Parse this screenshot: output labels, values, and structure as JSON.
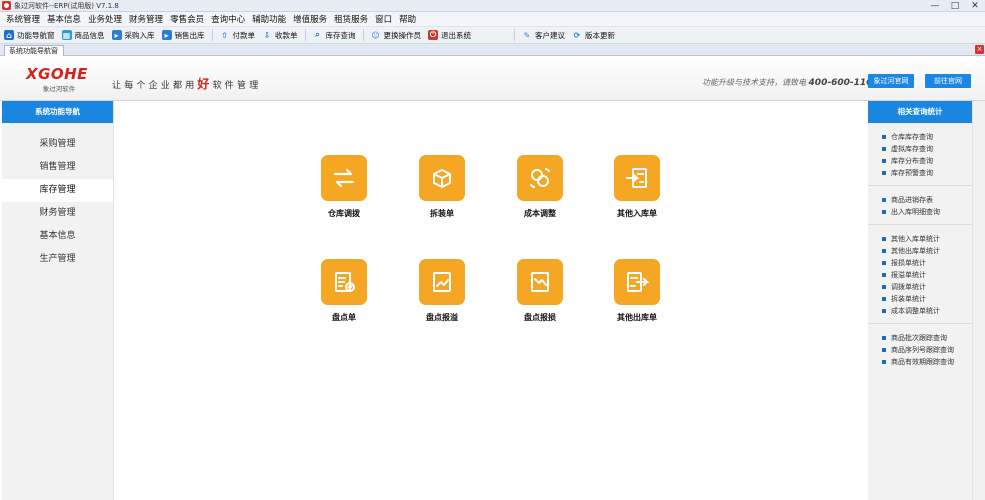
{
  "window": {
    "title": "象过河软件--ERP(试用版) V7.1.8",
    "controls": {
      "minimize": "—",
      "maximize": "□",
      "close": "✕"
    }
  },
  "menu": [
    "系统管理",
    "基本信息",
    "业务处理",
    "财务管理",
    "零售会员",
    "查询中心",
    "辅助功能",
    "增值服务",
    "租赁服务",
    "窗口",
    "帮助"
  ],
  "toolbar": [
    {
      "label": "功能导航窗",
      "icon": "home-icon",
      "color": "#1f6fd1"
    },
    {
      "label": "商品信息",
      "icon": "product-icon",
      "color": "#2b9bd8"
    },
    {
      "label": "采购入库",
      "icon": "purchase-in-icon",
      "color": "#2a7fd4"
    },
    {
      "label": "销售出库",
      "icon": "sales-out-icon",
      "color": "#2a7fd4"
    },
    {
      "label": "付款单",
      "icon": "payment-icon",
      "color": "#2a7fd4"
    },
    {
      "label": "收款单",
      "icon": "receipt-icon",
      "color": "#2a7fd4"
    },
    {
      "label": "库存查询",
      "icon": "inventory-search-icon",
      "color": "#1f6fd1"
    },
    {
      "label": "更换操作员",
      "icon": "switch-user-icon",
      "color": "#2a7fd4"
    },
    {
      "label": "退出系统",
      "icon": "exit-icon",
      "color": "#d2372d"
    },
    {
      "label": "客户建议",
      "icon": "feedback-icon",
      "color": "#2a7fd4"
    },
    {
      "label": "版本更新",
      "icon": "update-icon",
      "color": "#2a7fd4"
    }
  ],
  "doc_tab": {
    "label": "系统功能导航窗",
    "close": "×"
  },
  "banner": {
    "logo": "XGOHE",
    "logo_sub": "象过河软件",
    "slogan_before": "让每个企业都用",
    "slogan_big": "好",
    "slogan_after": "软件管理",
    "support_text": "功能升级与技术支持，请致电",
    "phone": "400-600-1168",
    "btn_official": "象过河官网",
    "btn_go": "前往官网"
  },
  "left_nav": {
    "header": "系统功能导航",
    "items": [
      "采购管理",
      "销售管理",
      "库存管理",
      "财务管理",
      "基本信息",
      "生产管理"
    ],
    "active_index": 2
  },
  "functions": [
    {
      "label": "仓库调拨",
      "icon": "warehouse-transfer-icon"
    },
    {
      "label": "拆装单",
      "icon": "assembly-icon"
    },
    {
      "label": "成本调整",
      "icon": "cost-adjust-icon"
    },
    {
      "label": "其他入库单",
      "icon": "other-in-icon"
    },
    {
      "label": "盘点单",
      "icon": "stocktake-icon"
    },
    {
      "label": "盘点报溢",
      "icon": "stock-surplus-icon"
    },
    {
      "label": "盘点报损",
      "icon": "stock-loss-icon"
    },
    {
      "label": "其他出库单",
      "icon": "other-out-icon"
    }
  ],
  "right_panel": {
    "header": "相关查询统计",
    "groups": [
      [
        "仓库库存查询",
        "虚拟库存查询",
        "库存分布查询",
        "库存预警查询"
      ],
      [
        "商品进销存表",
        "出入库明细查询"
      ],
      [
        "其他入库单统计",
        "其他出库单统计",
        "报损单统计",
        "报溢单统计",
        "调拨单统计",
        "拆装单统计",
        "成本调整单统计"
      ],
      [
        "商品批次跟踪查询",
        "商品序列号跟踪查询",
        "商品有效期跟踪查询"
      ]
    ]
  }
}
